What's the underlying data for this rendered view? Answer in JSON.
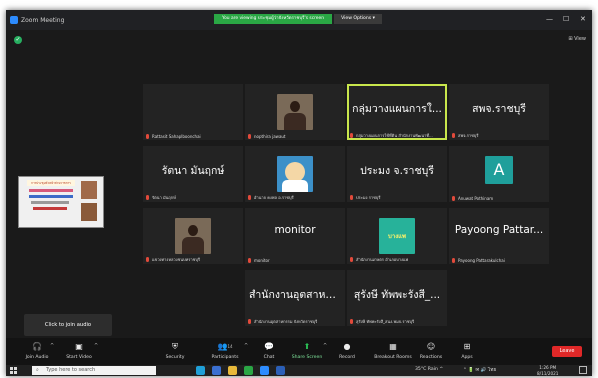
{
  "window": {
    "title": "Zoom Meeting",
    "banner": "You are viewing ประชุมผู้ว่าจังหวัดราชบุรี's screen",
    "view_options": "View Options ▾",
    "controls": [
      "—",
      "☐",
      "✕"
    ],
    "view_button": "⊞ View",
    "security_symbol": "✓"
  },
  "tiles": [
    {
      "name": "",
      "label": "Rattasit Sahaplboonchai",
      "kind": "blank"
    },
    {
      "name": "",
      "label": "nopthira jawaut",
      "kind": "person"
    },
    {
      "name": "กลุ่มวางแผนการใ...",
      "label": "กลุ่มวางแผนการใช้ที่ดิน สำนักงานพัฒนาที่...",
      "kind": "text",
      "active": true
    },
    {
      "name": "สพจ.ราชบุรี",
      "label": "สพจ.ราชบุรี",
      "kind": "text"
    },
    {
      "name": "รัตนา มันฤกษ์",
      "label": "รัตนา มันฤกษ์",
      "kind": "text"
    },
    {
      "name": "",
      "label": "อำนาจ คงพล อ.ราชบุรี",
      "kind": "cartoon"
    },
    {
      "name": "ประมง จ.ราชบุรี",
      "label": "ประมง ราชบุรี",
      "kind": "text"
    },
    {
      "name": "",
      "label": "Anuwat Pothinam",
      "kind": "avatar",
      "avatar_letter": "A"
    },
    {
      "name": "",
      "label": "แขวงทางหลวงชนบทราชบุรี",
      "kind": "person"
    },
    {
      "name": "monitor",
      "label": "monitor",
      "kind": "text"
    },
    {
      "name": "",
      "label": "สำนักงานเกษตร อำเภอบางแพ",
      "kind": "logo",
      "logo_text": "บางแพ"
    },
    {
      "name": "Payoong  Pattar...",
      "label": "Payoong Pattarakulchai",
      "kind": "text"
    },
    {
      "name": "สำนักงานอุตสาหก...",
      "label": "สำนักงานอุตสาหกรรม จังหวัดราชบุรี",
      "kind": "text"
    },
    {
      "name": "สุรังษี ทัพพะรังสี_...",
      "label": "สุรังษี ทัพพะรังสี_สนง.พมจ.ราชบุรี",
      "kind": "text"
    }
  ],
  "share_preview": {
    "header": "การประชุมหัวหน้าส่วนราชการ"
  },
  "join_popup": "Click to join audio",
  "toolbar": {
    "join_audio": {
      "label": "Join Audio",
      "icon": "headphones-icon"
    },
    "start_video": {
      "label": "Start Video",
      "icon": "video-off-icon"
    },
    "security": {
      "label": "Security",
      "icon": "shield-icon"
    },
    "participants": {
      "label": "Participants",
      "count": "14",
      "icon": "participants-icon"
    },
    "chat": {
      "label": "Chat",
      "icon": "chat-icon"
    },
    "share_screen": {
      "label": "Share Screen",
      "icon": "share-screen-icon"
    },
    "record": {
      "label": "Record",
      "icon": "record-icon"
    },
    "breakout": {
      "label": "Breakout Rooms",
      "icon": "breakout-icon"
    },
    "reactions": {
      "label": "Reactions",
      "icon": "reactions-icon"
    },
    "apps": {
      "label": "Apps",
      "icon": "apps-icon"
    },
    "leave": "Leave"
  },
  "taskbar": {
    "search_placeholder": "Type here to search",
    "weather": "35°C  Rain  ^",
    "sys": "⌃ 🔋 ✉ 🔊 ไทย",
    "time": "1:26 PM",
    "date": "8/11/2021"
  },
  "colors": {
    "accent": "#2d8cff",
    "banner": "#2aa745",
    "leave": "#e02828",
    "active_speaker": "#c8e64c"
  }
}
